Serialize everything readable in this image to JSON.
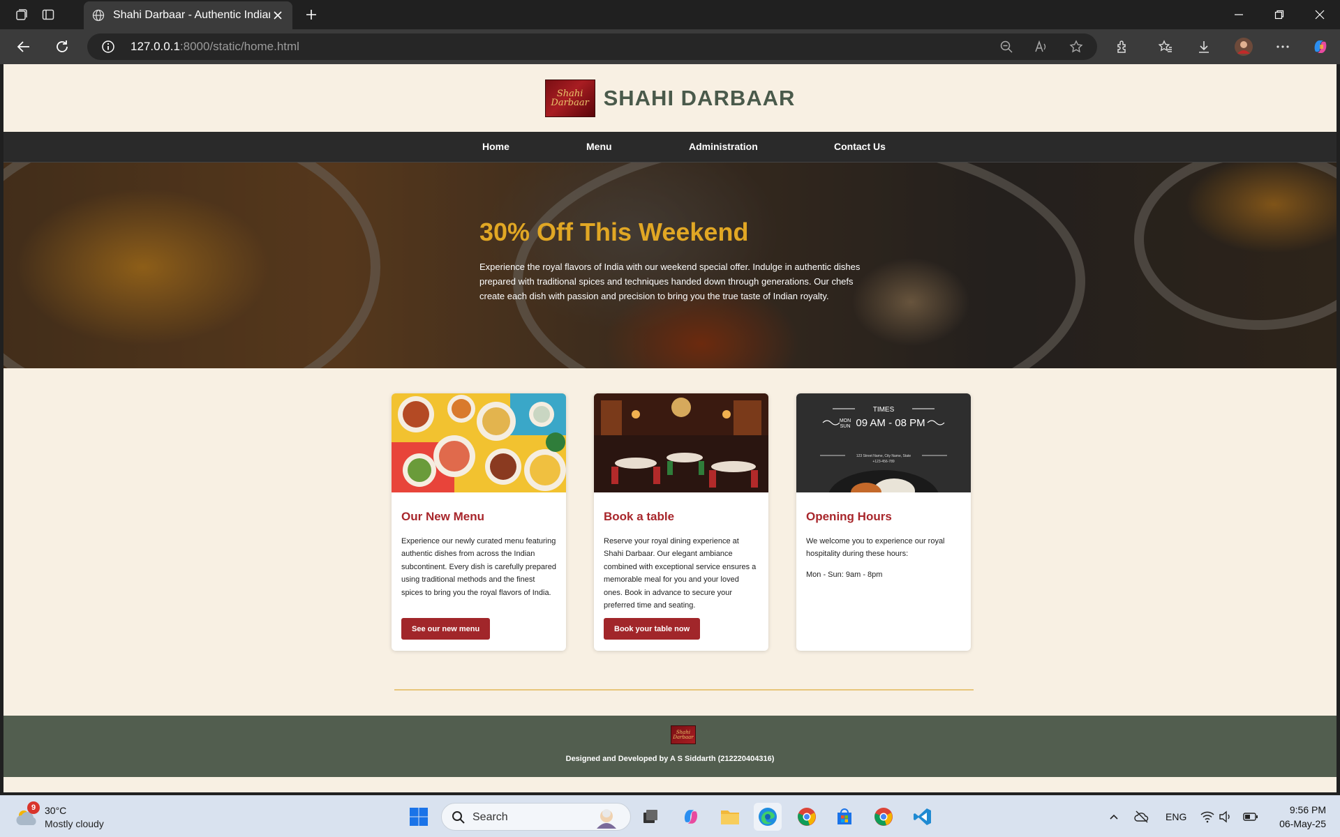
{
  "browser": {
    "tab_title": "Shahi Darbaar - Authentic Indian Cuisine",
    "url_host": "127.0.0.1",
    "url_rest": ":8000/static/home.html"
  },
  "site": {
    "logo_text_1": "Shahi",
    "logo_text_2": "Darbaar",
    "name": "SHAHI DARBAAR",
    "nav": [
      "Home",
      "Menu",
      "Administration",
      "Contact Us"
    ]
  },
  "hero": {
    "title": "30% Off This Weekend",
    "text": "Experience the royal flavors of India with our weekend special offer. Indulge in authentic dishes prepared with traditional spices and techniques handed down through generations. Our chefs create each dish with passion and precision to bring you the true taste of Indian royalty."
  },
  "cards": [
    {
      "title": "Our New Menu",
      "text": "Experience our newly curated menu featuring authentic dishes from across the Indian subcontinent. Every dish is carefully prepared using traditional methods and the finest spices to bring you the royal flavors of India.",
      "button": "See our new menu"
    },
    {
      "title": "Book a table",
      "text": "Reserve your royal dining experience at Shahi Darbaar. Our elegant ambiance combined with exceptional service ensures a memorable meal for you and your loved ones. Book in advance to secure your preferred time and seating.",
      "button": "Book your table now"
    },
    {
      "title": "Opening Hours",
      "text": "We welcome you to experience our royal hospitality during these hours:",
      "hours": "Mon - Sun: 9am - 8pm",
      "image_text": {
        "times": "TIMES",
        "days_top": "MON",
        "days_bottom": "SUN",
        "range": "09 AM - 08 PM",
        "address": "123 Street Name, City Name, State",
        "phone": "+123-456-789"
      }
    }
  ],
  "footer": {
    "text": "Designed and Developed by A S Siddarth (212220404316)"
  },
  "taskbar": {
    "weather_badge": "9",
    "temperature": "30°C",
    "condition": "Mostly cloudy",
    "search_label": "Search",
    "language": "ENG",
    "time": "9:56 PM",
    "date": "06-May-25"
  },
  "colors": {
    "page_bg": "#f8f0e3",
    "accent_red": "#a1262a",
    "hero_title_gold": "#e1a724",
    "footer_green": "#525e4f",
    "divider_gold": "#e8c57a"
  }
}
